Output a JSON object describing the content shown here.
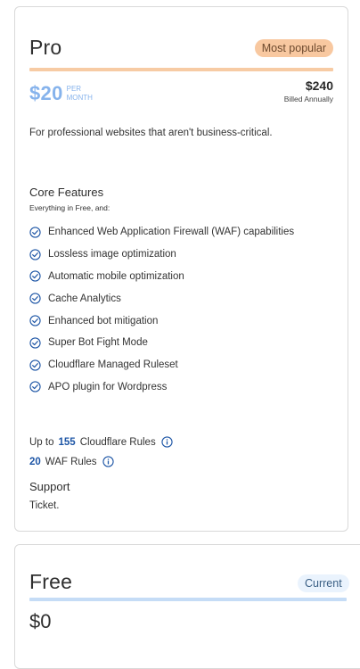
{
  "pro": {
    "title": "Pro",
    "badge": "Most popular",
    "monthly_price": "$20",
    "per_top": "PER",
    "per_bottom": "MONTH",
    "annual_price": "$240",
    "annual_note": "Billed Annually",
    "description": "For professional websites that aren't business-critical.",
    "core_features_title": "Core Features",
    "core_features_sub": "Everything in Free, and:",
    "features": [
      {
        "label": "Enhanced Web Application Firewall (WAF) capabilities",
        "icon": "check-circle-icon"
      },
      {
        "label": "Lossless image optimization",
        "icon": "check-circle-icon"
      },
      {
        "label": "Automatic mobile optimization",
        "icon": "check-circle-icon"
      },
      {
        "label": "Cache Analytics",
        "icon": "check-circle-icon"
      },
      {
        "label": "Enhanced bot mitigation",
        "icon": "check-circle-icon"
      },
      {
        "label": "Super Bot Fight Mode",
        "icon": "check-circle-icon"
      },
      {
        "label": "Cloudflare Managed Ruleset",
        "icon": "check-circle-icon"
      },
      {
        "label": "APO plugin for Wordpress",
        "icon": "check-circle-icon"
      }
    ],
    "rules": {
      "cf_prefix": "Up to",
      "cf_count": "155",
      "cf_label": "Cloudflare Rules",
      "waf_count": "20",
      "waf_label": "WAF Rules"
    },
    "support_title": "Support",
    "support_text": "Ticket."
  },
  "free": {
    "title": "Free",
    "badge": "Current",
    "price": "$0"
  },
  "colors": {
    "accent_blue": "#1e56a6",
    "light_blue": "#86b3ec",
    "pro_bar": "#f7cba4",
    "free_bar": "#c5dcf6",
    "badge_orange": "#f8c8a0"
  }
}
